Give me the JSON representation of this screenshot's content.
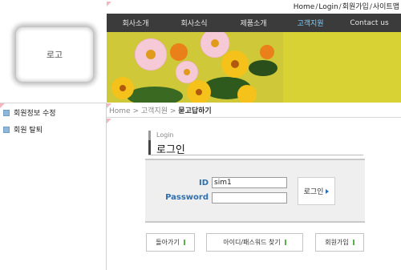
{
  "util_links": [
    "Home",
    "Login",
    "회원가입",
    "사이트맵"
  ],
  "util_sep": "/",
  "logo_text": "로고",
  "nav": {
    "items": [
      "회사소개",
      "회사소식",
      "제품소개",
      "고객지원",
      "Contact us"
    ],
    "active_index": 3,
    "active_color": "#7fd0ff"
  },
  "sidebar": {
    "items": [
      "회원정보 수정",
      "회원 탈퇴"
    ]
  },
  "breadcrumb": {
    "home": "Home",
    "section": "고객지원",
    "current": "묻고답하기",
    "sep": ">"
  },
  "login": {
    "small_label": "Login",
    "title": "로그인",
    "id_label": "ID",
    "id_value": "sim1",
    "password_label": "Password",
    "password_value": "",
    "submit_label": "로그인"
  },
  "buttons": {
    "back": "돌아가기",
    "find": "아이디/패스워드 찾기",
    "join": "회원가입"
  },
  "colors": {
    "nav_bg": "#3b3b3b",
    "banner_bg": "#d9d32e",
    "label_blue": "#2e6fb0",
    "icon_green": "#5ab04a"
  }
}
